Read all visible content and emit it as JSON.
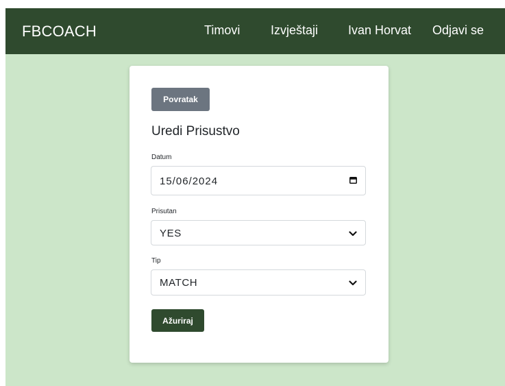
{
  "navbar": {
    "brand": "FBCOACH",
    "links": {
      "teams": "Timovi",
      "reports": "Izvještaji",
      "user": "Ivan Horvat",
      "logout": "Odjavi se"
    }
  },
  "form": {
    "back_label": "Povratak",
    "title": "Uredi Prisustvo",
    "fields": {
      "date": {
        "label": "Datum",
        "value": "15/06/2024",
        "icon": "calendar-icon"
      },
      "present": {
        "label": "Prisutan",
        "value": "YES",
        "icon": "chevron-down-icon"
      },
      "type": {
        "label": "Tip",
        "value": "MATCH",
        "icon": "chevron-down-icon"
      }
    },
    "submit_label": "Ažuriraj"
  },
  "colors": {
    "navbar_bg": "#2f4a2e",
    "page_bg": "#cce6c9",
    "back_button": "#6c7580",
    "primary_button": "#2f4a2e"
  }
}
